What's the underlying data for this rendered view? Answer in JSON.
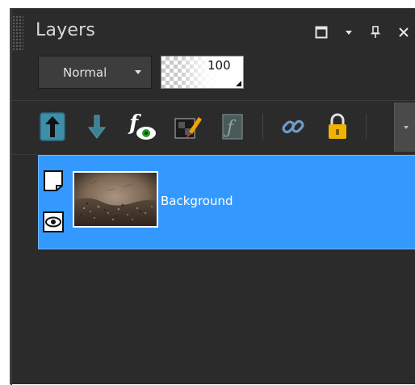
{
  "panel": {
    "title": "Layers",
    "title_buttons": [
      {
        "name": "maximize-icon"
      },
      {
        "name": "menu-caret-icon"
      },
      {
        "name": "pin-icon"
      },
      {
        "name": "close-icon"
      }
    ]
  },
  "blend_mode": {
    "selected": "Normal"
  },
  "opacity": {
    "value": "100"
  },
  "toolbar": {
    "icons": [
      "move-layer-up-icon",
      "move-layer-down-icon",
      "layer-effects-icon",
      "layer-mask-icon",
      "script-icon",
      "link-icon",
      "lock-icon"
    ]
  },
  "layers": [
    {
      "name": "Background",
      "visible": true,
      "selected": true
    }
  ],
  "colors": {
    "panel_bg": "#2b2b2b",
    "selection": "#3399ff",
    "arrow_teal": "#3d8fa8",
    "lock_gold": "#f0b400"
  }
}
